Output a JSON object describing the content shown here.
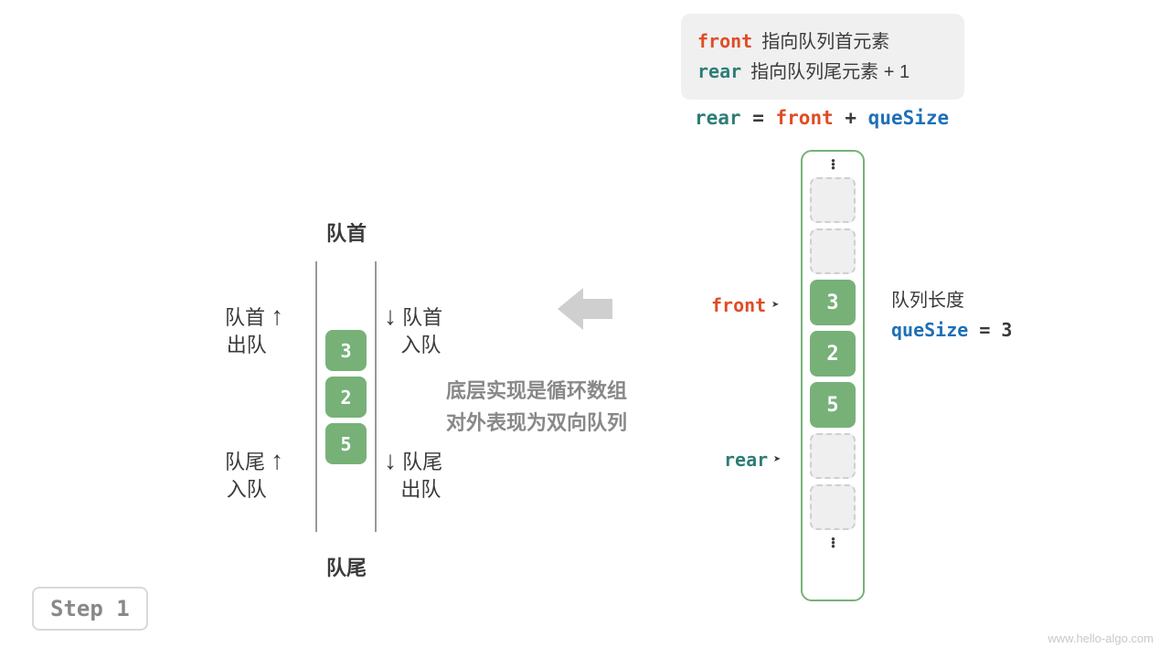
{
  "legend": {
    "front_kw": "front",
    "front_desc": "指向队列首元素",
    "rear_kw": "rear",
    "rear_desc": "指向队列尾元素 + 1"
  },
  "formula": {
    "rear": "rear",
    "eq1": " = ",
    "front": "front",
    "plus": " + ",
    "qsize": "queSize"
  },
  "array": {
    "values": [
      "3",
      "2",
      "5"
    ],
    "front_label": "front",
    "rear_label": "rear",
    "qs_title": "队列长度",
    "qs_kw": "queSize",
    "qs_eq": " = 3"
  },
  "deque": {
    "head": "队首",
    "tail": "队尾",
    "values": [
      "3",
      "2",
      "5"
    ],
    "top_left_l1": "队首",
    "top_left_l2": "出队",
    "top_right_l1": "队首",
    "top_right_l2": "入队",
    "bot_left_l1": "队尾",
    "bot_left_l2": "入队",
    "bot_right_l1": "队尾",
    "bot_right_l2": "出队"
  },
  "explain": {
    "l1": "底层实现是循环数组",
    "l2": "对外表现为双向队列"
  },
  "step": "Step 1",
  "watermark": "www.hello-algo.com"
}
